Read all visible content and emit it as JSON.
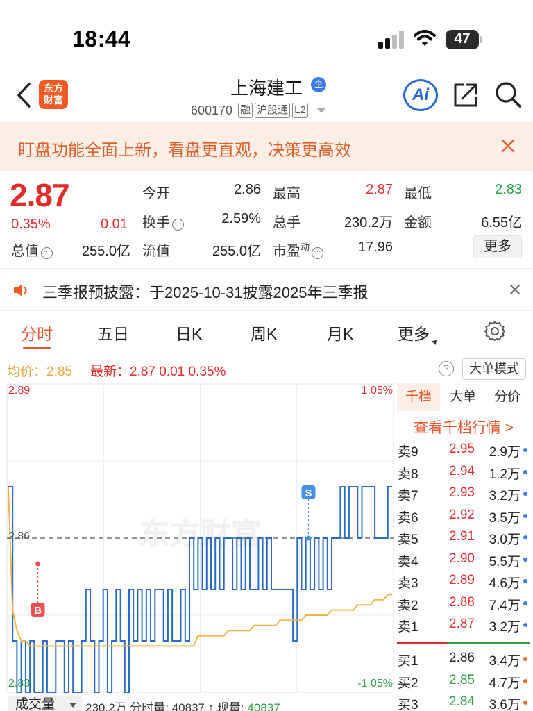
{
  "status_bar": {
    "time": "18:44",
    "battery": "47"
  },
  "header": {
    "app_logo_line1": "东方",
    "app_logo_line2": "财富",
    "stock_name": "上海建工",
    "enterprise_badge": "企",
    "stock_code": "600170",
    "tags": [
      "融",
      "沪股通",
      "L2"
    ],
    "ai_label": "Ai"
  },
  "banner": {
    "text": "盯盘功能全面上新，看盘更直观，决策更高效"
  },
  "quote": {
    "price": "2.87",
    "change_pct": "0.35%",
    "change_abs": "0.01",
    "fields": [
      {
        "label": "今开",
        "value": "2.86",
        "color": "#222222"
      },
      {
        "label": "最高",
        "value": "2.87",
        "color": "#e12c2c"
      },
      {
        "label": "最低",
        "value": "2.83",
        "color": "#2aa043"
      },
      {
        "label": "换手",
        "value": "2.59%",
        "color": "#222222"
      },
      {
        "label": "总手",
        "value": "230.2万",
        "color": "#222222"
      },
      {
        "label": "金额",
        "value": "6.55亿",
        "color": "#222222"
      },
      {
        "label": "总值",
        "value": "255.0亿",
        "color": "#222222"
      },
      {
        "label": "流值",
        "value": "255.0亿",
        "color": "#222222"
      },
      {
        "label": "市盈",
        "value": "17.96",
        "color": "#222222",
        "superscript": "动"
      }
    ],
    "more_label": "更多"
  },
  "announcement": {
    "text": "三季报预披露：于2025-10-31披露2025年三季报"
  },
  "tabs": [
    {
      "label": "分时",
      "active": true
    },
    {
      "label": "五日",
      "active": false
    },
    {
      "label": "日K",
      "active": false
    },
    {
      "label": "周K",
      "active": false
    },
    {
      "label": "月K",
      "active": false
    },
    {
      "label": "更多",
      "active": false
    }
  ],
  "subinfo": {
    "avg_label": "均价：2.85",
    "last_label": "最新：2.87  0.01  0.35%",
    "help": "?",
    "big_order_mode": "大单模式"
  },
  "chart_data": {
    "type": "line",
    "watermark": "东方财富",
    "y_labels": {
      "top": "2.89",
      "mid": "2.86",
      "bottom": "2.83"
    },
    "pct_labels": {
      "top": "1.05%",
      "bottom": "-1.05%"
    },
    "ylim": [
      2.83,
      2.89
    ],
    "prev_close": 2.86,
    "colors": {
      "price": "#2a6cc4",
      "avg": "#f0b54a",
      "prev_close_line": "#555555"
    },
    "price_series": [
      2.87,
      2.84,
      2.83,
      2.84,
      2.83,
      2.84,
      2.83,
      2.83,
      2.84,
      2.83,
      2.83,
      2.84,
      2.84,
      2.83,
      2.84,
      2.83,
      2.83,
      2.84,
      2.85,
      2.84,
      2.83,
      2.84,
      2.85,
      2.83,
      2.84,
      2.85,
      2.84,
      2.83,
      2.85,
      2.84,
      2.85,
      2.84,
      2.85,
      2.84,
      2.85,
      2.85,
      2.84,
      2.85,
      2.84,
      2.84,
      2.85,
      2.84,
      2.86,
      2.85,
      2.86,
      2.85,
      2.86,
      2.85,
      2.86,
      2.85,
      2.86,
      2.86,
      2.85,
      2.86,
      2.85,
      2.86,
      2.85,
      2.85,
      2.86,
      2.85,
      2.86,
      2.85,
      2.85,
      2.85,
      2.85,
      2.85,
      2.84,
      2.86,
      2.85,
      2.86,
      2.85,
      2.86,
      2.85,
      2.86,
      2.85,
      2.86,
      2.86,
      2.87,
      2.86,
      2.87,
      2.87,
      2.86,
      2.87,
      2.87,
      2.87,
      2.86,
      2.86,
      2.86,
      2.87,
      2.87
    ],
    "avg_series": [
      2.87,
      2.846,
      2.842,
      2.84,
      2.84,
      2.839,
      2.839,
      2.839,
      2.839,
      2.839,
      2.839,
      2.839,
      2.839,
      2.839,
      2.839,
      2.839,
      2.839,
      2.839,
      2.839,
      2.839,
      2.839,
      2.839,
      2.839,
      2.839,
      2.839,
      2.839,
      2.839,
      2.839,
      2.839,
      2.839,
      2.839,
      2.839,
      2.839,
      2.839,
      2.839,
      2.839,
      2.839,
      2.839,
      2.839,
      2.839,
      2.839,
      2.839,
      2.839,
      2.839,
      2.841,
      2.841,
      2.841,
      2.841,
      2.841,
      2.841,
      2.841,
      2.842,
      2.842,
      2.842,
      2.842,
      2.842,
      2.842,
      2.843,
      2.843,
      2.843,
      2.843,
      2.843,
      2.843,
      2.844,
      2.844,
      2.844,
      2.844,
      2.844,
      2.844,
      2.845,
      2.845,
      2.845,
      2.845,
      2.845,
      2.845,
      2.846,
      2.846,
      2.846,
      2.846,
      2.846,
      2.846,
      2.847,
      2.847,
      2.847,
      2.847,
      2.848,
      2.848,
      2.848,
      2.849,
      2.849
    ],
    "markers": [
      {
        "label": "B",
        "price": 2.855,
        "at": 0.08,
        "color": "#f05050"
      },
      {
        "label": "S",
        "price": 2.86,
        "at": 0.78,
        "color": "#4a90e2"
      }
    ]
  },
  "order_book": {
    "tabs": [
      {
        "label": "千档",
        "active": true
      },
      {
        "label": "大单",
        "active": false
      },
      {
        "label": "分价",
        "active": false
      }
    ],
    "link": "查看千档行情 >",
    "asks": [
      {
        "label": "卖9",
        "price": "2.95",
        "volume": "2.9万",
        "dot": "#3b7be5"
      },
      {
        "label": "卖8",
        "price": "2.94",
        "volume": "1.2万",
        "dot": "#3b7be5"
      },
      {
        "label": "卖7",
        "price": "2.93",
        "volume": "3.2万",
        "dot": "#3b7be5"
      },
      {
        "label": "卖6",
        "price": "2.92",
        "volume": "3.5万",
        "dot": "#3b7be5"
      },
      {
        "label": "卖5",
        "price": "2.91",
        "volume": "3.0万",
        "dot": "#3b7be5"
      },
      {
        "label": "卖4",
        "price": "2.90",
        "volume": "5.5万",
        "dot": "#3b7be5"
      },
      {
        "label": "卖3",
        "price": "2.89",
        "volume": "4.6万",
        "dot": "#3b7be5"
      },
      {
        "label": "卖2",
        "price": "2.88",
        "volume": "7.4万",
        "dot": "#3b7be5"
      },
      {
        "label": "卖1",
        "price": "2.87",
        "volume": "3.2万",
        "dot": "#3b7be5"
      }
    ],
    "ask_price_color": "#e12c2c",
    "bids": [
      {
        "label": "买1",
        "price": "2.86",
        "volume": "3.4万",
        "color": "#222222",
        "dot": "#ef6a2b"
      },
      {
        "label": "买2",
        "price": "2.85",
        "volume": "4.7万",
        "color": "#2aa043",
        "dot": "#ef6a2b"
      },
      {
        "label": "买3",
        "price": "2.84",
        "volume": "3.6万",
        "color": "#2aa043",
        "dot": "#ef6a2b"
      }
    ]
  },
  "volume_row": {
    "selector": "成交量",
    "text_prefix": "230.2万 分时量: 40837 ↑ 现量: ",
    "current_volume": "40837"
  }
}
